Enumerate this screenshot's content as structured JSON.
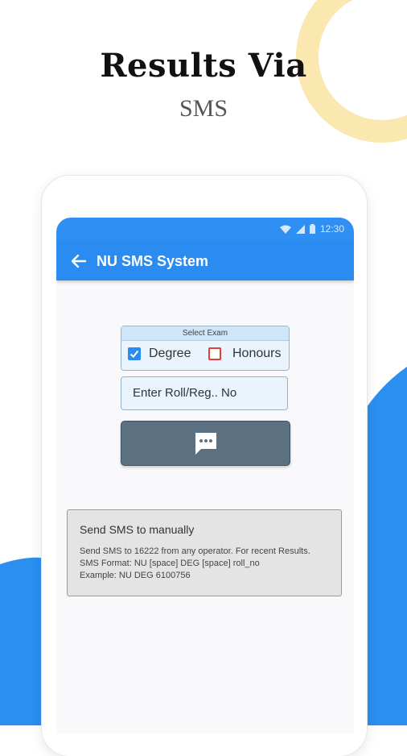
{
  "promo": {
    "title": "Results Via",
    "subtitle": "SMS"
  },
  "statusbar": {
    "time": "12:30"
  },
  "appbar": {
    "title": "NU SMS System"
  },
  "exam": {
    "header": "Select Exam",
    "options": [
      {
        "label": "Degree",
        "checked": true
      },
      {
        "label": "Honours",
        "checked": false
      }
    ]
  },
  "roll_input": {
    "placeholder": "Enter Roll/Reg.. No"
  },
  "send_button": {
    "icon": "message-icon"
  },
  "manual": {
    "title": "Send SMS to manually",
    "lines": [
      "Send SMS to 16222 from any operator. For recent Results.",
      "SMS Format: NU [space] DEG [space] roll_no",
      "Example: NU DEG 6100756"
    ]
  },
  "colors": {
    "primary": "#2a8cf0",
    "accent_yellow": "#fbe8b0",
    "wave_blue": "#2b8ff0",
    "button": "#5b7181"
  }
}
